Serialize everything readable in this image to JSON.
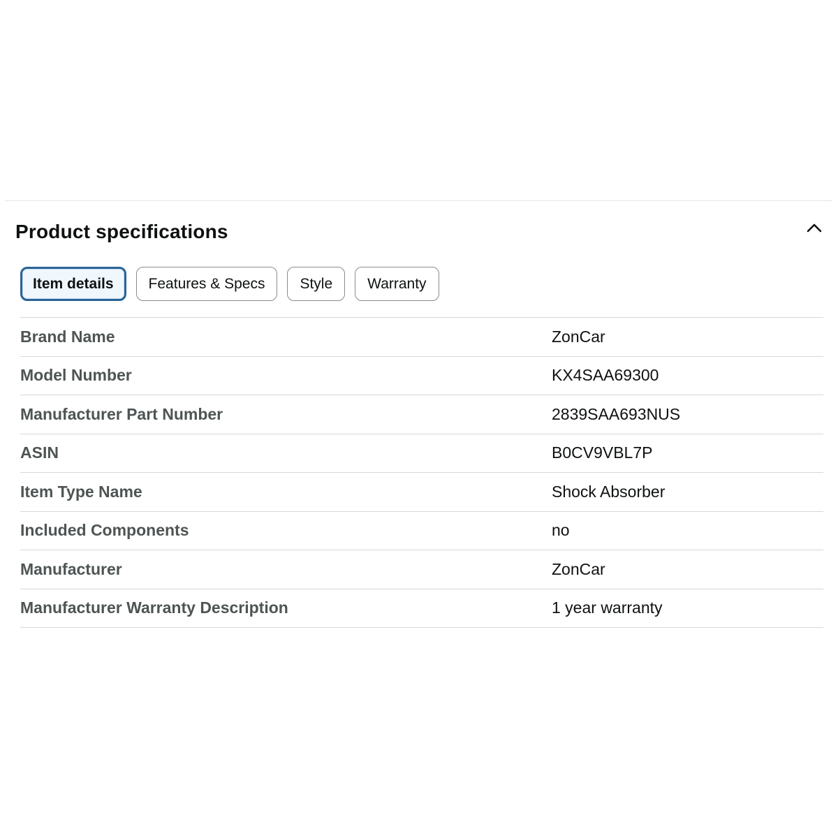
{
  "section": {
    "title": "Product specifications",
    "toggle_icon": "chevron-up-icon"
  },
  "tabs": [
    {
      "label": "Item details",
      "active": true
    },
    {
      "label": "Features & Specs",
      "active": false
    },
    {
      "label": "Style",
      "active": false
    },
    {
      "label": "Warranty",
      "active": false
    }
  ],
  "specs": [
    {
      "label": "Brand Name",
      "value": "ZonCar"
    },
    {
      "label": "Model Number",
      "value": "KX4SAA69300"
    },
    {
      "label": "Manufacturer Part Number",
      "value": "2839SAA693NUS"
    },
    {
      "label": "ASIN",
      "value": "B0CV9VBL7P"
    },
    {
      "label": "Item Type Name",
      "value": "Shock Absorber"
    },
    {
      "label": "Included Components",
      "value": "no"
    },
    {
      "label": "Manufacturer",
      "value": "ZonCar"
    },
    {
      "label": "Manufacturer Warranty Description",
      "value": "1 year warranty"
    }
  ],
  "colors": {
    "active_tab_border": "#2a6496",
    "label_text": "#4e5454",
    "value_text": "#0f1111",
    "divider": "#d5d9d9"
  }
}
